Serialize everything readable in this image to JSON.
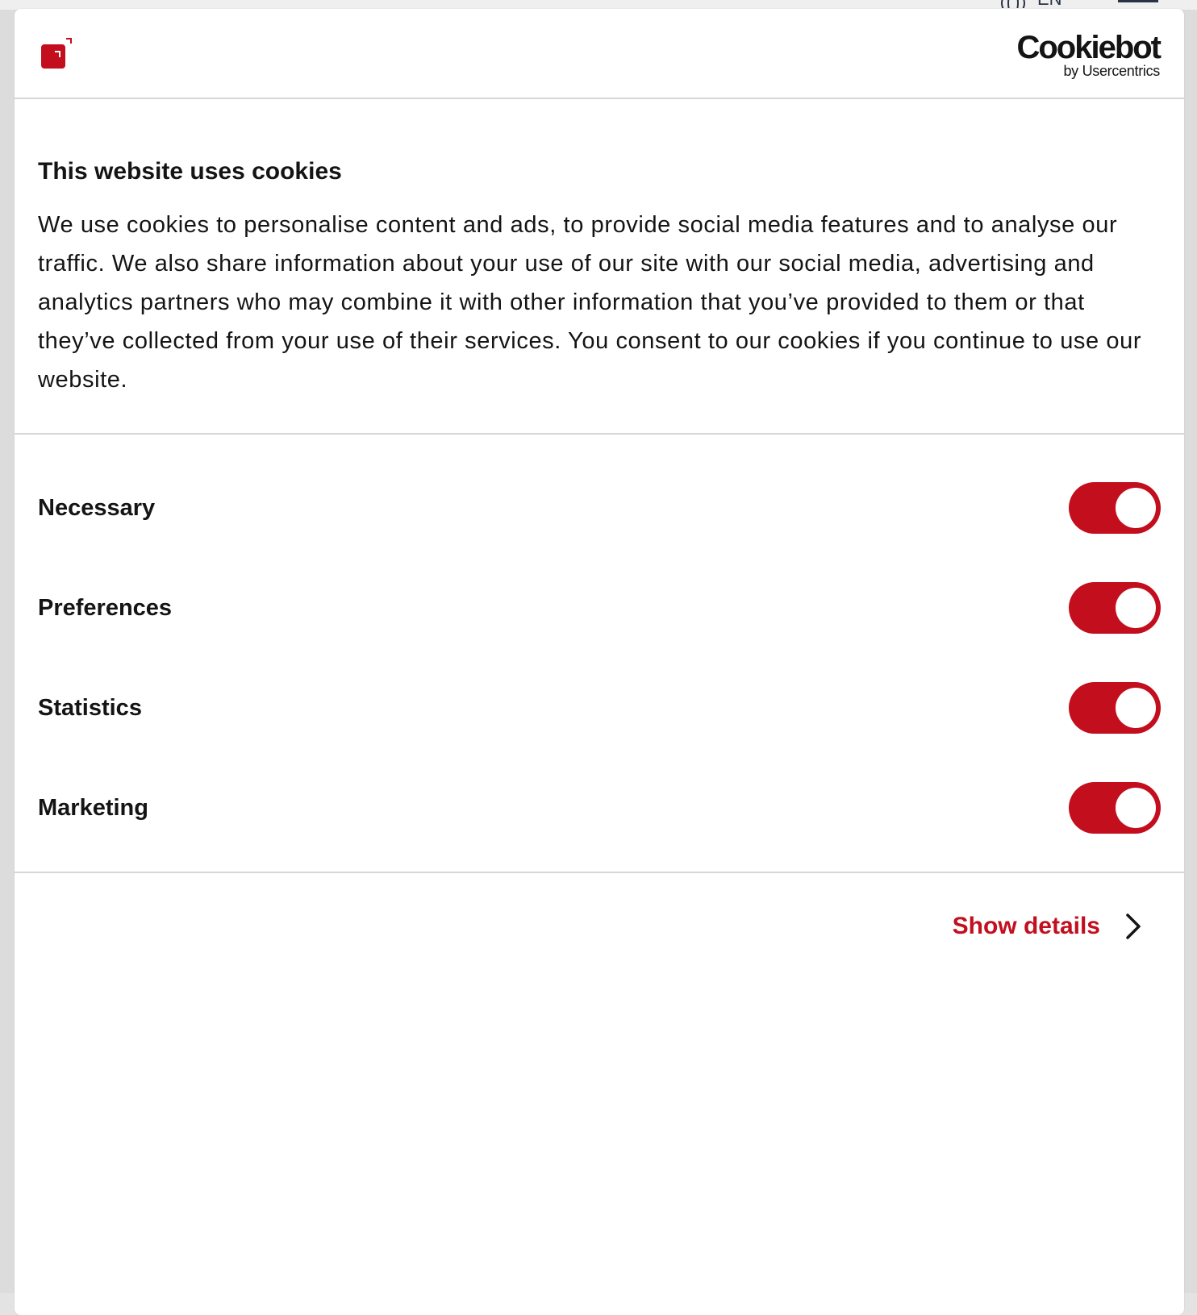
{
  "background": {
    "language_code": "EN"
  },
  "header": {
    "brand_logo": "brand-logo-icon",
    "cookiebot": {
      "name": "Cookiebot",
      "sub": "by Usercentrics"
    }
  },
  "intro": {
    "title": "This website uses cookies",
    "body": "We use cookies to personalise content and ads, to provide social media features and to analyse our traffic. We also share information about your use of our site with our social media, advertising and analytics partners who may combine it with other information that you’ve provided to them or that they’ve collected from your use of their services. You consent to our cookies if you continue to use our website."
  },
  "toggles": [
    {
      "label": "Necessary",
      "enabled": true
    },
    {
      "label": "Preferences",
      "enabled": true
    },
    {
      "label": "Statistics",
      "enabled": true
    },
    {
      "label": "Marketing",
      "enabled": true
    }
  ],
  "footer": {
    "show_details_label": "Show details",
    "icon": "chevron-right-icon"
  },
  "colors": {
    "accent": "#c30e1e",
    "text": "#141414",
    "divider": "#d6d6d6"
  }
}
